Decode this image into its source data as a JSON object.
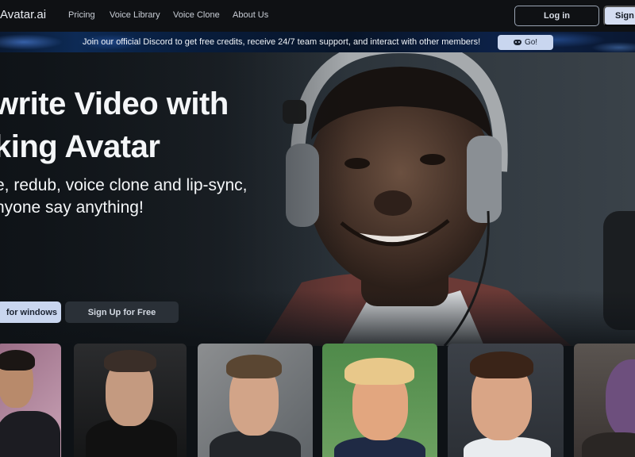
{
  "nav": {
    "brand": "Avatar.ai",
    "links": [
      "Pricing",
      "Voice Library",
      "Voice Clone",
      "About Us"
    ],
    "login": "Log in",
    "signup": "Sign Up"
  },
  "banner": {
    "text": "Join our official Discord to get free credits, receive 24/7 team support, and interact with other members!",
    "go": "Go!",
    "go_icon": "discord-icon"
  },
  "hero": {
    "title_line1": "write Video with",
    "title_line2": "king Avatar",
    "sub_line1": "e, redub, voice clone and lip-sync,",
    "sub_line2": "nyone say anything!",
    "download": "for windows",
    "signup": "Sign Up for Free"
  },
  "colors": {
    "accent_button": "#c9d6ef",
    "dark_button": "#2a3037",
    "background": "#0e1216"
  }
}
